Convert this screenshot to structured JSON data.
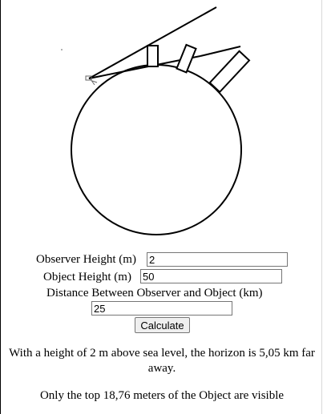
{
  "form": {
    "observer_label": "Observer Height (m)",
    "observer_value": "2",
    "object_label": "Object Height (m)",
    "object_value": "50",
    "distance_label": "Distance Between Observer and Object (km)",
    "distance_value": "25",
    "calculate_label": "Calculate"
  },
  "results": {
    "horizon_text": "With a height of 2 m above sea level, the horizon is 5,05 km far away.",
    "visible_text": "Only the top 18,76 meters of the Object are visible"
  }
}
